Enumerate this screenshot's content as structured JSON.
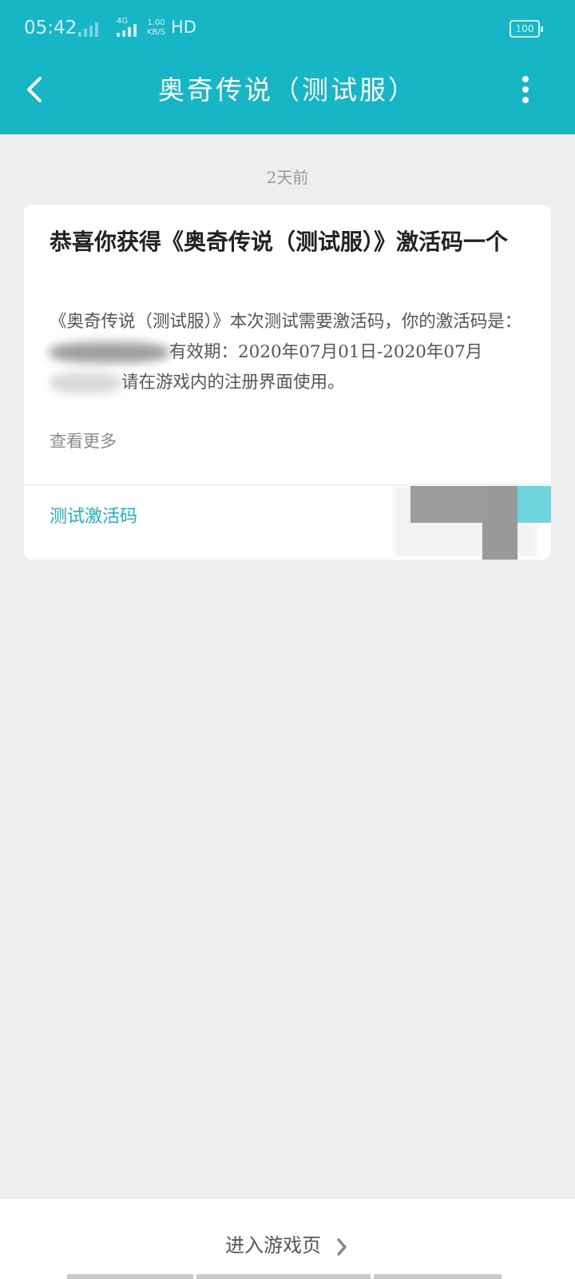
{
  "status_bar": {
    "time": "05:42",
    "network": "4G",
    "speed_value": "1.00",
    "speed_unit": "KB/S",
    "hd": "HD",
    "battery": "100"
  },
  "header": {
    "title": "奥奇传说（测试服）",
    "back_icon": "chevron-left-icon",
    "more_icon": "more-vertical-icon",
    "color": "#17b6c6"
  },
  "message": {
    "time": "2天前",
    "title": "恭喜你获得《奥奇传说（测试服）》激活码一个",
    "body_part1": "《奥奇传说（测试服）》本次测试需要激活码，你的激活码是：",
    "body_part2": "有效期：2020年07月01日-2020年07月",
    "body_part3": "请在游戏内的注册界面使用。",
    "see_more": "查看更多",
    "action_label": "测试激活码",
    "action_color": "#17b6c6"
  },
  "footer": {
    "enter_label": "进入游戏页",
    "chevron_icon": "chevron-right-icon"
  }
}
